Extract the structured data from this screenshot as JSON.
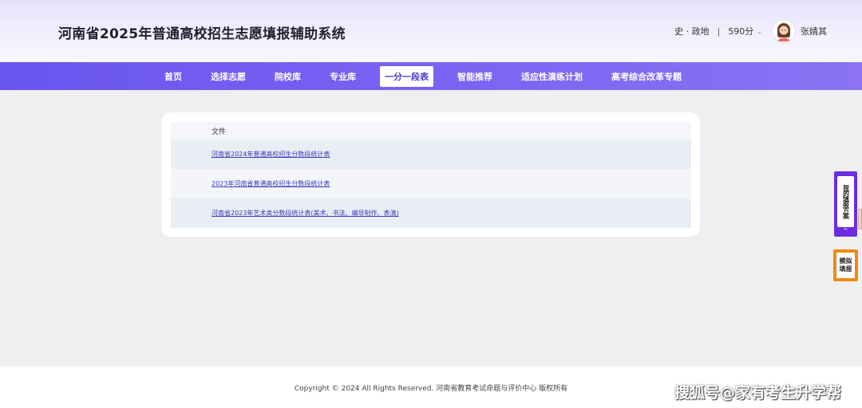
{
  "header": {
    "title": "河南省2025年普通高校招生志愿填报辅助系统",
    "subjects": "史 · 政地",
    "separator": "|",
    "score": "590分",
    "score_chevron_icon": "chevron-down-icon",
    "avatar_icon": "user-avatar-icon",
    "user_name": "张婧其"
  },
  "nav": {
    "items": [
      {
        "label": "首页"
      },
      {
        "label": "选择志愿"
      },
      {
        "label": "院校库"
      },
      {
        "label": "专业库"
      },
      {
        "label": "一分一段表",
        "active": true
      },
      {
        "label": "智能推荐"
      },
      {
        "label": "适应性演练计划"
      },
      {
        "label": "高考综合改革专题"
      }
    ]
  },
  "files": {
    "header": "文件",
    "rows": [
      {
        "label": "河南省2024年普通高校招生分数段统计表"
      },
      {
        "label": "2023年河南省普通高校招生分数段统计表"
      },
      {
        "label": "河南省2023年艺术类分数段统计表(美术、书法、编导制作、表演)"
      }
    ]
  },
  "side": {
    "plan_label": "我的填报方案",
    "plan_arrow": "^",
    "mock_label_1": "模拟",
    "mock_label_2": "填报"
  },
  "footer": {
    "copyright": "Copyright © 2024 All Rights Reserved. 河南省教育考试命题与评价中心 版权所有",
    "watermark": "搜狐号@家有考生升学帮"
  },
  "colors": {
    "nav_bg": "#7a63f2",
    "active_tab_text": "#4a3bcf",
    "link": "#3a3ab8",
    "side_plan": "#6c2de0",
    "side_mock": "#f08a10"
  }
}
